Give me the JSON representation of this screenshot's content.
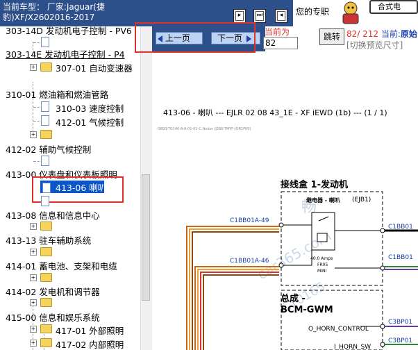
{
  "top": {
    "vehicle_label": "当前车型：",
    "vehicle_value": "厂家:Jaguar(捷豹)XF/X2602016-2017",
    "toolbar_buttons": [
      {
        "icon": "next-page-icon",
        "glyph": "▸"
      },
      {
        "icon": "fast-forward-icon",
        "glyph": "⏭"
      },
      {
        "icon": "prev-page-icon",
        "glyph": "◂"
      }
    ],
    "brand_text": "您的专职",
    "brand_box_text": "合式电"
  },
  "tree": {
    "items": [
      {
        "label": "303-14D 发动机电子控制 - PV6"
      },
      {
        "label": "303-14E 发动机电子控制 - P4"
      },
      {
        "label": "307-01 自动变速器"
      },
      {
        "label": "310-01 燃油箱和燃油管路"
      },
      {
        "label": "310-03 速度控制"
      },
      {
        "label": "412-01 气候控制"
      },
      {
        "label": "412-02 辅助气候控制"
      },
      {
        "label": "413-00 仪表盘和仪表板照明"
      },
      {
        "label": "413-06 喇叭"
      },
      {
        "label": "413-08 信息和信息中心"
      },
      {
        "label": "413-13 驻车辅助系统"
      },
      {
        "label": "414-01 蓄电池、支架和电缆"
      },
      {
        "label": "414-02 发电机和调节器"
      },
      {
        "label": "415-00 信息和娱乐系统"
      },
      {
        "label": "417-01 外部照明"
      },
      {
        "label": "417-02 内部照明"
      }
    ]
  },
  "nav": {
    "prev_label": "上一页",
    "next_label": "下一页",
    "current_label": "当前为",
    "page_value": "82",
    "jump_label": "跳转",
    "page_count": "82/ 212",
    "current_prefix": "当前:",
    "current_mode": "原始",
    "preview_label": "[切换预览尺寸]"
  },
  "document": {
    "title": "413-06 - 喇叭 --- EJLR 02 08 43_1E - XF iEWD (1b) --- (1 / 1)",
    "subtitle": "G893-TG140-A-A-01-01-C.Hndss (J266-TMYF-JOR1PK0)",
    "junction_title": "接线盒 1-发动机",
    "ejb_label": "(EJB1)",
    "relay_label": "继电器 - 喇叭",
    "fuse_label_1": "40.0 Amps",
    "fuse_label_2": "FR05",
    "fuse_label_3": "MINI",
    "conn_1": "C1BB01A-49",
    "conn_2": "C1BB01A-46",
    "conn_right_1": "C1BB01",
    "conn_right_2": "C1BB01",
    "bcm_title_1": "总成 -",
    "bcm_title_2": "BCM-GWM",
    "horn_control": "O_HORN_CONTROL",
    "horn_sw": "I_HORN_SW",
    "conn_right_3": "C3BP01",
    "conn_right_4": "C3BP01",
    "watermark_1": "畅",
    "watermark_2": "car365.com",
    "watermark_3": "CY0165"
  }
}
